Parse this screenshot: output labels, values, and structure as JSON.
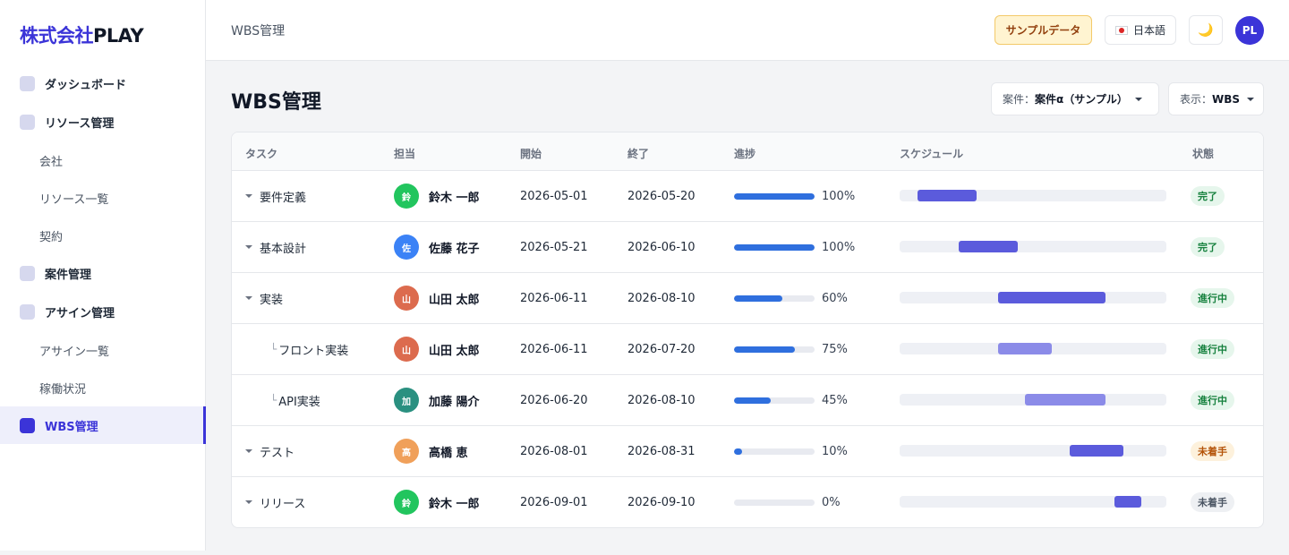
{
  "sidebar": {
    "logo_part1": "株式会社",
    "logo_part2": "PLAY",
    "items": {
      "dashboard": "ダッシュボード",
      "resource": "リソース管理",
      "company": "会社",
      "resource_list": "リソース一覧",
      "contract": "契約",
      "project": "案件管理",
      "assign": "アサイン管理",
      "assign_list": "アサイン一覧",
      "utilization": "稼働状況",
      "wbs": "WBS管理"
    }
  },
  "header": {
    "breadcrumb": "WBS管理",
    "sample_badge": "サンプルデータ",
    "language": "日本語",
    "theme_icon": "🌙",
    "user_initials": "PL"
  },
  "main": {
    "title": "WBS管理",
    "project_filter": {
      "label": "案件：",
      "value": "案件α（サンプル）"
    },
    "view_filter": {
      "label": "表示：",
      "value": "WBS"
    },
    "columns": {
      "task": "タスク",
      "assignee": "担当",
      "start": "開始",
      "end": "終了",
      "progress": "進捗",
      "schedule": "スケジュール",
      "status": "状態"
    },
    "rows": [
      {
        "task": "要件定義",
        "tree": "",
        "assignee": "鈴木 一郎",
        "avatar_char": "鈴",
        "avatar_color": "#22c55e",
        "start": "2026-05-01",
        "end": "2026-05-20",
        "progress": 100,
        "progress_text": "100%",
        "status": "完了",
        "status_fg": "#15803d",
        "status_bg": "#e6f6ec"
      },
      {
        "task": "基本設計",
        "tree": "",
        "assignee": "佐藤 花子",
        "avatar_char": "佐",
        "avatar_color": "#3b82f6",
        "start": "2026-05-21",
        "end": "2026-06-10",
        "progress": 100,
        "progress_text": "100%",
        "status": "完了",
        "status_fg": "#15803d",
        "status_bg": "#e6f6ec"
      },
      {
        "task": "実装",
        "tree": "",
        "assignee": "山田 太郎",
        "avatar_char": "山",
        "avatar_color": "#dc6b4e",
        "start": "2026-06-11",
        "end": "2026-08-10",
        "progress": 60,
        "progress_text": "60%",
        "status": "進行中",
        "status_fg": "#15803d",
        "status_bg": "#e6f6ec"
      },
      {
        "task": "フロント実装",
        "tree": "└",
        "assignee": "山田 太郎",
        "avatar_char": "山",
        "avatar_color": "#dc6b4e",
        "start": "2026-06-11",
        "end": "2026-07-20",
        "progress": 75,
        "progress_text": "75%",
        "status": "進行中",
        "status_fg": "#15803d",
        "status_bg": "#e6f6ec"
      },
      {
        "task": "API実装",
        "tree": "└",
        "assignee": "加藤 陽介",
        "avatar_char": "加",
        "avatar_color": "#2a9080",
        "start": "2026-06-20",
        "end": "2026-08-10",
        "progress": 45,
        "progress_text": "45%",
        "status": "進行中",
        "status_fg": "#15803d",
        "status_bg": "#e6f6ec"
      },
      {
        "task": "テスト",
        "tree": "",
        "assignee": "高橋 恵",
        "avatar_char": "高",
        "avatar_color": "#f0a05a",
        "start": "2026-08-01",
        "end": "2026-08-31",
        "progress": 10,
        "progress_text": "10%",
        "status": "未着手",
        "status_fg": "#b45309",
        "status_bg": "#fdf1dc"
      },
      {
        "task": "リリース",
        "tree": "",
        "assignee": "鈴木 一郎",
        "avatar_char": "鈴",
        "avatar_color": "#22c55e",
        "start": "2026-09-01",
        "end": "2026-09-10",
        "progress": 0,
        "progress_text": "0%",
        "status": "未着手",
        "status_fg": "#4b5563",
        "status_bg": "#eef0f3"
      }
    ]
  },
  "colors": {
    "accent": "#3b34d8",
    "progress": "#2f6fde",
    "gantt_bar": "#5b5bdc",
    "gantt_bar_sub": "#8b8be8"
  }
}
